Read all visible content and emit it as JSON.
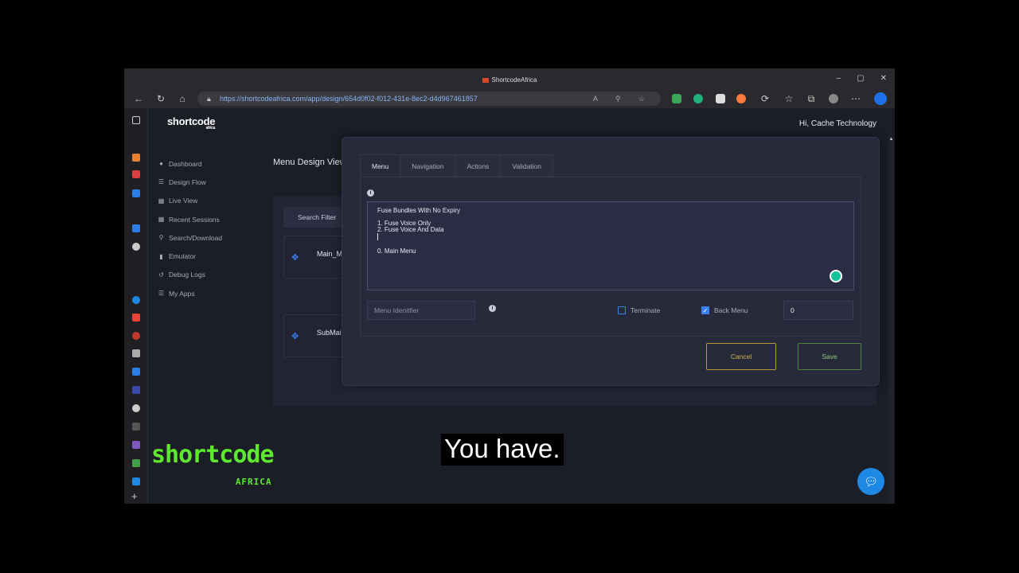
{
  "browser": {
    "tab_title": "ShortcodeAfrica",
    "url": "https://shortcodeafrica.com/app/design/654d0f02-f012-431e-8ec2-d4d967461857",
    "window_controls": [
      "–",
      "▢",
      "✕"
    ]
  },
  "app": {
    "logo": "shortcode",
    "logo_sub": "africa",
    "greeting": "Hi, Cache Technology",
    "sidebar": [
      {
        "label": "Dashboard",
        "icon": "dashboard-icon"
      },
      {
        "label": "Design Flow",
        "icon": "list-icon"
      },
      {
        "label": "Live View",
        "icon": "grid-icon"
      },
      {
        "label": "Recent Sessions",
        "icon": "grid-icon"
      },
      {
        "label": "Search/Download",
        "icon": "search-icon"
      },
      {
        "label": "Emulator",
        "icon": "phone-icon"
      },
      {
        "label": "Debug Logs",
        "icon": "history-icon"
      },
      {
        "label": "My Apps",
        "icon": "list-icon"
      }
    ],
    "page_title": "Menu Design View",
    "search_filter": "Search Filter",
    "cards": [
      "Main_M",
      "SubMai"
    ]
  },
  "modal": {
    "tabs": [
      "Menu",
      "Navigation",
      "Actions",
      "Validation"
    ],
    "active_tab": "Menu",
    "menu_text": {
      "line1": "Fuse Bundles With No Expiry",
      "line2": "1. Fuse Voice Only",
      "line3": "2. Fuse  Voice And Data",
      "line4": "0. Main Menu"
    },
    "identifier_placeholder": "Menu Idenitfier",
    "terminate_label": "Terminate",
    "terminate_checked": false,
    "back_menu_label": "Back Menu",
    "back_menu_checked": true,
    "number_value": "0",
    "cancel_label": "Cancel",
    "save_label": "Save"
  },
  "overlay": {
    "brand": "shortcode",
    "brand_sub": "AFRICA",
    "caption": "You have."
  }
}
